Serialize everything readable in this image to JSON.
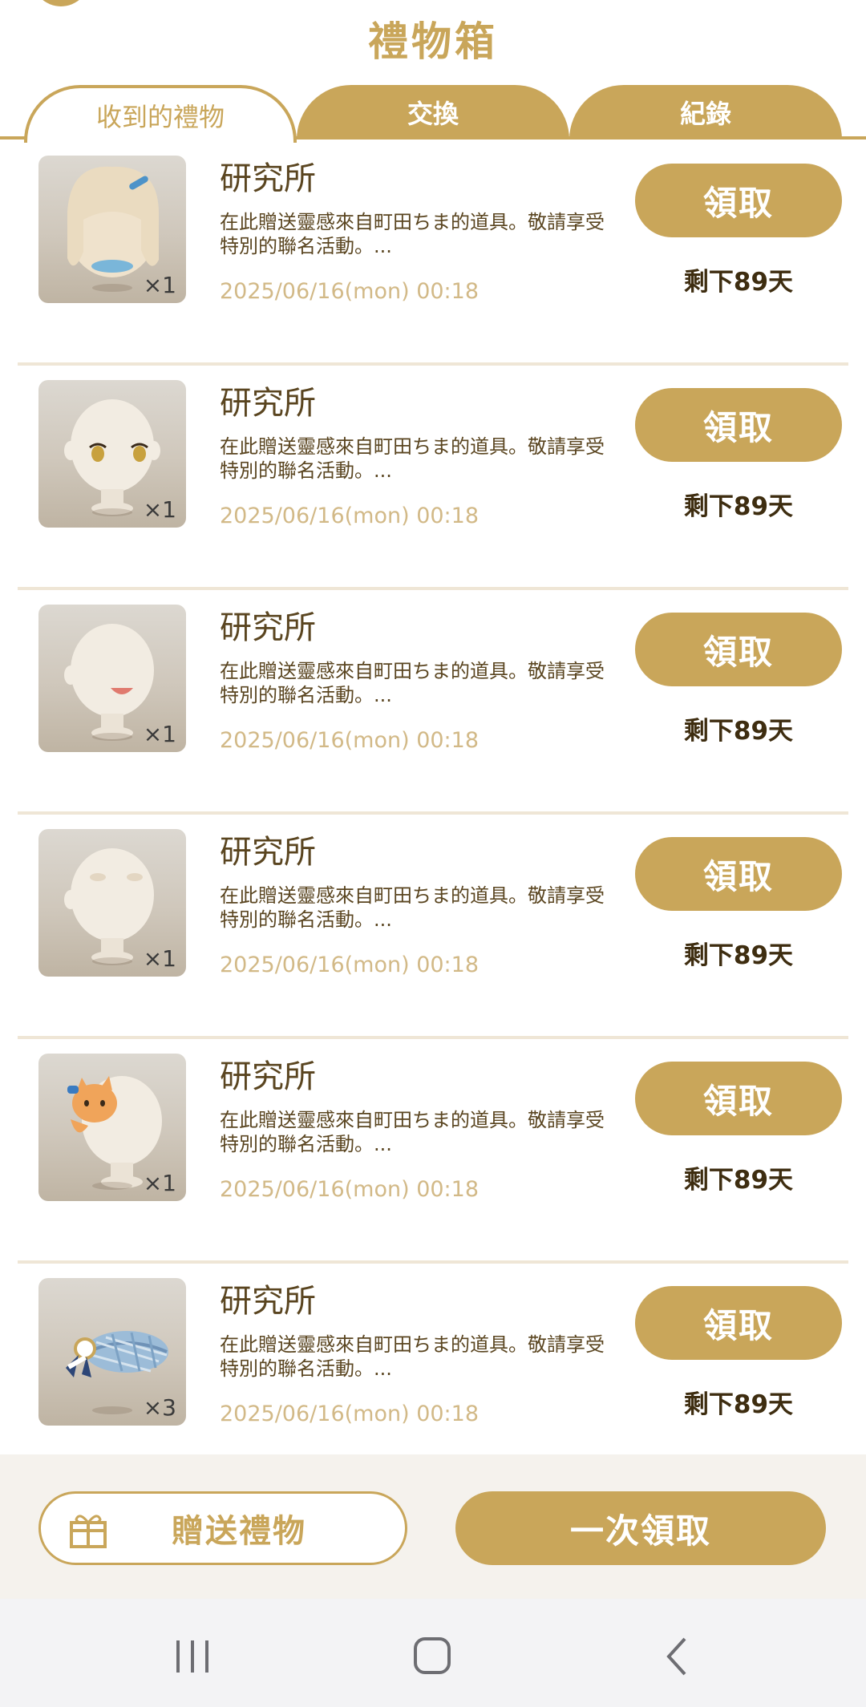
{
  "header": {
    "title": "禮物箱"
  },
  "tabs": [
    {
      "label": "收到的禮物",
      "active": true
    },
    {
      "label": "交換",
      "active": false
    },
    {
      "label": "紀錄",
      "active": false
    }
  ],
  "colors": {
    "accent": "#c9a65a",
    "text_dark": "#5a4520",
    "date_text": "#d2b987",
    "divider": "#efe6d6"
  },
  "gifts": [
    {
      "sender": "研究所",
      "description": "在此贈送靈感來自町田ちま的道具。敬請享受特別的聯名活動。...",
      "date": "2025/06/16(mon) 00:18",
      "quantity": "×1",
      "claim_label": "領取",
      "remaining": "剩下89天",
      "icon": "blonde-hair-item-icon"
    },
    {
      "sender": "研究所",
      "description": "在此贈送靈感來自町田ちま的道具。敬請享受特別的聯名活動。...",
      "date": "2025/06/16(mon) 00:18",
      "quantity": "×1",
      "claim_label": "領取",
      "remaining": "剩下89天",
      "icon": "eyes-item-icon"
    },
    {
      "sender": "研究所",
      "description": "在此贈送靈感來自町田ちま的道具。敬請享受特別的聯名活動。...",
      "date": "2025/06/16(mon) 00:18",
      "quantity": "×1",
      "claim_label": "領取",
      "remaining": "剩下89天",
      "icon": "mouth-item-icon"
    },
    {
      "sender": "研究所",
      "description": "在此贈送靈感來自町田ちま的道具。敬請享受特別的聯名活動。...",
      "date": "2025/06/16(mon) 00:18",
      "quantity": "×1",
      "claim_label": "領取",
      "remaining": "剩下89天",
      "icon": "eyebrows-item-icon"
    },
    {
      "sender": "研究所",
      "description": "在此贈送靈感來自町田ちま的道具。敬請享受特別的聯名活動。...",
      "date": "2025/06/16(mon) 00:18",
      "quantity": "×1",
      "claim_label": "領取",
      "remaining": "剩下89天",
      "icon": "cat-accessory-item-icon"
    },
    {
      "sender": "研究所",
      "description": "在此贈送靈感來自町田ちま的道具。敬請享受特別的聯名活動。...",
      "date": "2025/06/16(mon) 00:18",
      "quantity": "×3",
      "claim_label": "領取",
      "remaining": "剩下89天",
      "icon": "plaid-hat-item-icon"
    }
  ],
  "footer": {
    "send_gift_label": "贈送禮物",
    "claim_all_label": "一次領取"
  },
  "system_nav": {
    "recents": "recents-icon",
    "home": "home-icon",
    "back": "back-icon"
  }
}
